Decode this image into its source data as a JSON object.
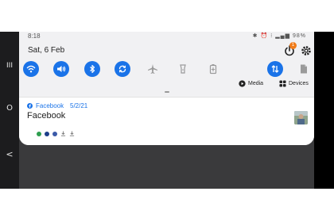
{
  "nav": {
    "recents_glyph": "III",
    "home_glyph": "O",
    "back_glyph": "<"
  },
  "status_bar": {
    "time": "8:18",
    "icons_text": "✱ ⏰ ⁝ ▂▄▆",
    "battery": "98%"
  },
  "header": {
    "date": "Sat, 6 Feb",
    "power_badge": "1"
  },
  "quick_settings": [
    {
      "name": "wifi",
      "state": "on"
    },
    {
      "name": "sound",
      "state": "on"
    },
    {
      "name": "bluetooth",
      "state": "on"
    },
    {
      "name": "auto-rotate",
      "state": "on"
    },
    {
      "name": "airplane-mode",
      "state": "off"
    },
    {
      "name": "flashlight",
      "state": "off"
    },
    {
      "name": "battery-saver",
      "state": "off"
    },
    {
      "name": "mobile-data",
      "state": "on"
    },
    {
      "name": "document",
      "state": "off"
    }
  ],
  "controls": {
    "media_label": "Media",
    "devices_label": "Devices"
  },
  "notification": {
    "app_name": "Facebook",
    "date": "5/2/21",
    "title": "Facebook"
  },
  "colors": {
    "accent": "#1a73e8",
    "badge": "#f07c1a"
  }
}
